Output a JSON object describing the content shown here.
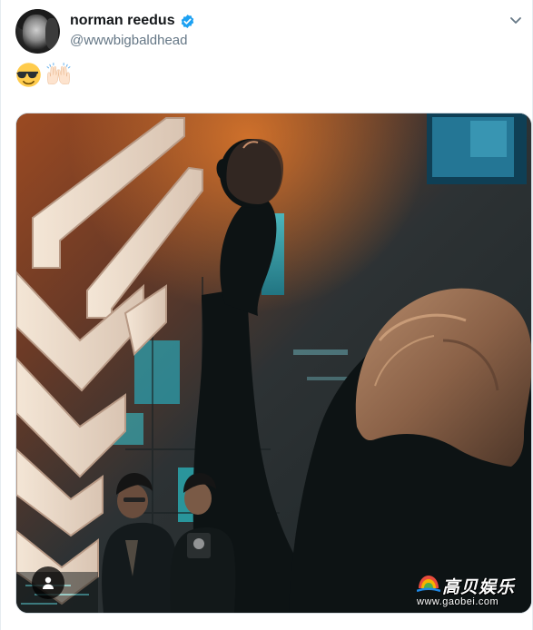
{
  "tweet": {
    "display_name": "norman reedus",
    "handle": "@wwwbigbaldhead",
    "verified": true,
    "body_emojis": [
      "smiling-face-with-sunglasses",
      "raising-hands"
    ]
  },
  "media": {
    "description_icons": [
      "user-tag-icon"
    ]
  },
  "watermark": {
    "title": "高贝娱乐",
    "url": "www.gaobei.com"
  },
  "colors": {
    "name": "#14171a",
    "handle": "#657786",
    "verified": "#1da1f2",
    "border": "#e6ecf0"
  }
}
